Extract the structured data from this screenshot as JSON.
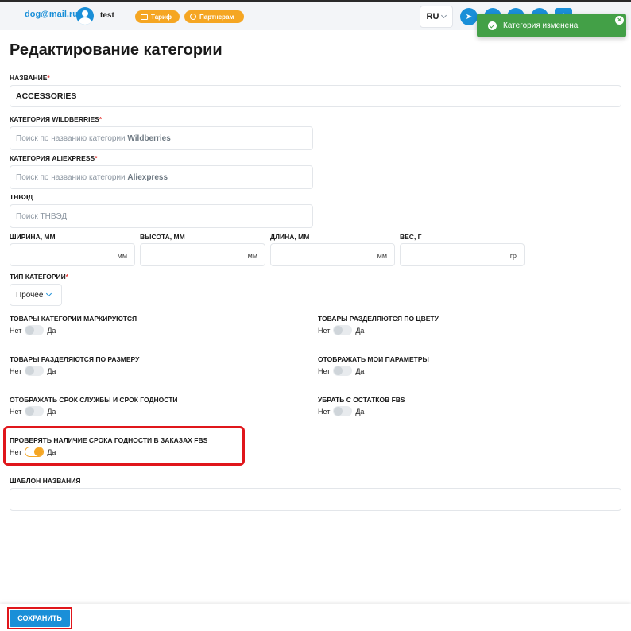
{
  "header": {
    "email": "dog@mail.ru",
    "username": "test",
    "tarif_label": "Тариф",
    "partner_label": "Партнерам",
    "language": "RU",
    "accent_color": "#1a8fd8",
    "pill_color": "#f5a623",
    "icons": [
      "telegram-icon",
      "arrow-icon",
      "share-icon",
      "question-icon",
      "puzzle-icon"
    ]
  },
  "toast": {
    "message": "Категория изменена",
    "color": "#43a047"
  },
  "page": {
    "title": "Редактирование категории"
  },
  "form": {
    "name": {
      "label": "НАЗВАНИЕ",
      "required": "*",
      "value": "ACCESSORIES"
    },
    "wildberries": {
      "label": "КАТЕГОРИЯ WILDBERRIES",
      "required": "*",
      "placeholder_prefix": "Поиск по названию категории ",
      "placeholder_brand": "Wildberries"
    },
    "aliexpress": {
      "label": "КАТЕГОРИЯ ALIEXPRESS",
      "required": "*",
      "placeholder_prefix": "Поиск по названию категории ",
      "placeholder_brand": "Aliexpress"
    },
    "tnved": {
      "label": "ТНВЭД",
      "placeholder": "Поиск ТНВЭД"
    },
    "width": {
      "label": "ШИРИНА, ММ",
      "unit": "мм"
    },
    "height": {
      "label": "ВЫСОТА, ММ",
      "unit": "мм"
    },
    "length": {
      "label": "ДЛИНА, ММ",
      "unit": "мм"
    },
    "weight": {
      "label": "ВЕС, Г",
      "unit": "гр"
    },
    "category_type": {
      "label": "ТИП КАТЕГОРИИ",
      "required": "*",
      "value": "Прочее"
    },
    "toggles": [
      {
        "label": "ТОВАРЫ КАТЕГОРИИ МАРКИРУЮТСЯ",
        "off": "Нет",
        "on": "Да",
        "checked": false
      },
      {
        "label": "ТОВАРЫ РАЗДЕЛЯЮТСЯ ПО ЦВЕТУ",
        "off": "Нет",
        "on": "Да",
        "checked": false
      },
      {
        "label": "ТОВАРЫ РАЗДЕЛЯЮТСЯ ПО РАЗМЕРУ",
        "off": "Нет",
        "on": "Да",
        "checked": false
      },
      {
        "label": "ОТОБРАЖАТЬ МОИ ПАРАМЕТРЫ",
        "off": "Нет",
        "on": "Да",
        "checked": false
      },
      {
        "label": "ОТОБРАЖАТЬ СРОК СЛУЖБЫ И СРОК ГОДНОСТИ",
        "off": "Нет",
        "on": "Да",
        "checked": false
      },
      {
        "label": "УБРАТЬ С ОСТАТКОВ FBS",
        "off": "Нет",
        "on": "Да",
        "checked": false
      },
      {
        "label": "ПРОВЕРЯТЬ НАЛИЧИЕ СРОКА ГОДНОСТИ В ЗАКАЗАХ FBS",
        "off": "Нет",
        "on": "Да",
        "checked": true
      }
    ],
    "name_template": {
      "label": "ШАБЛОН НАЗВАНИЯ"
    }
  },
  "footer": {
    "save_label": "СОХРАНИТЬ"
  }
}
